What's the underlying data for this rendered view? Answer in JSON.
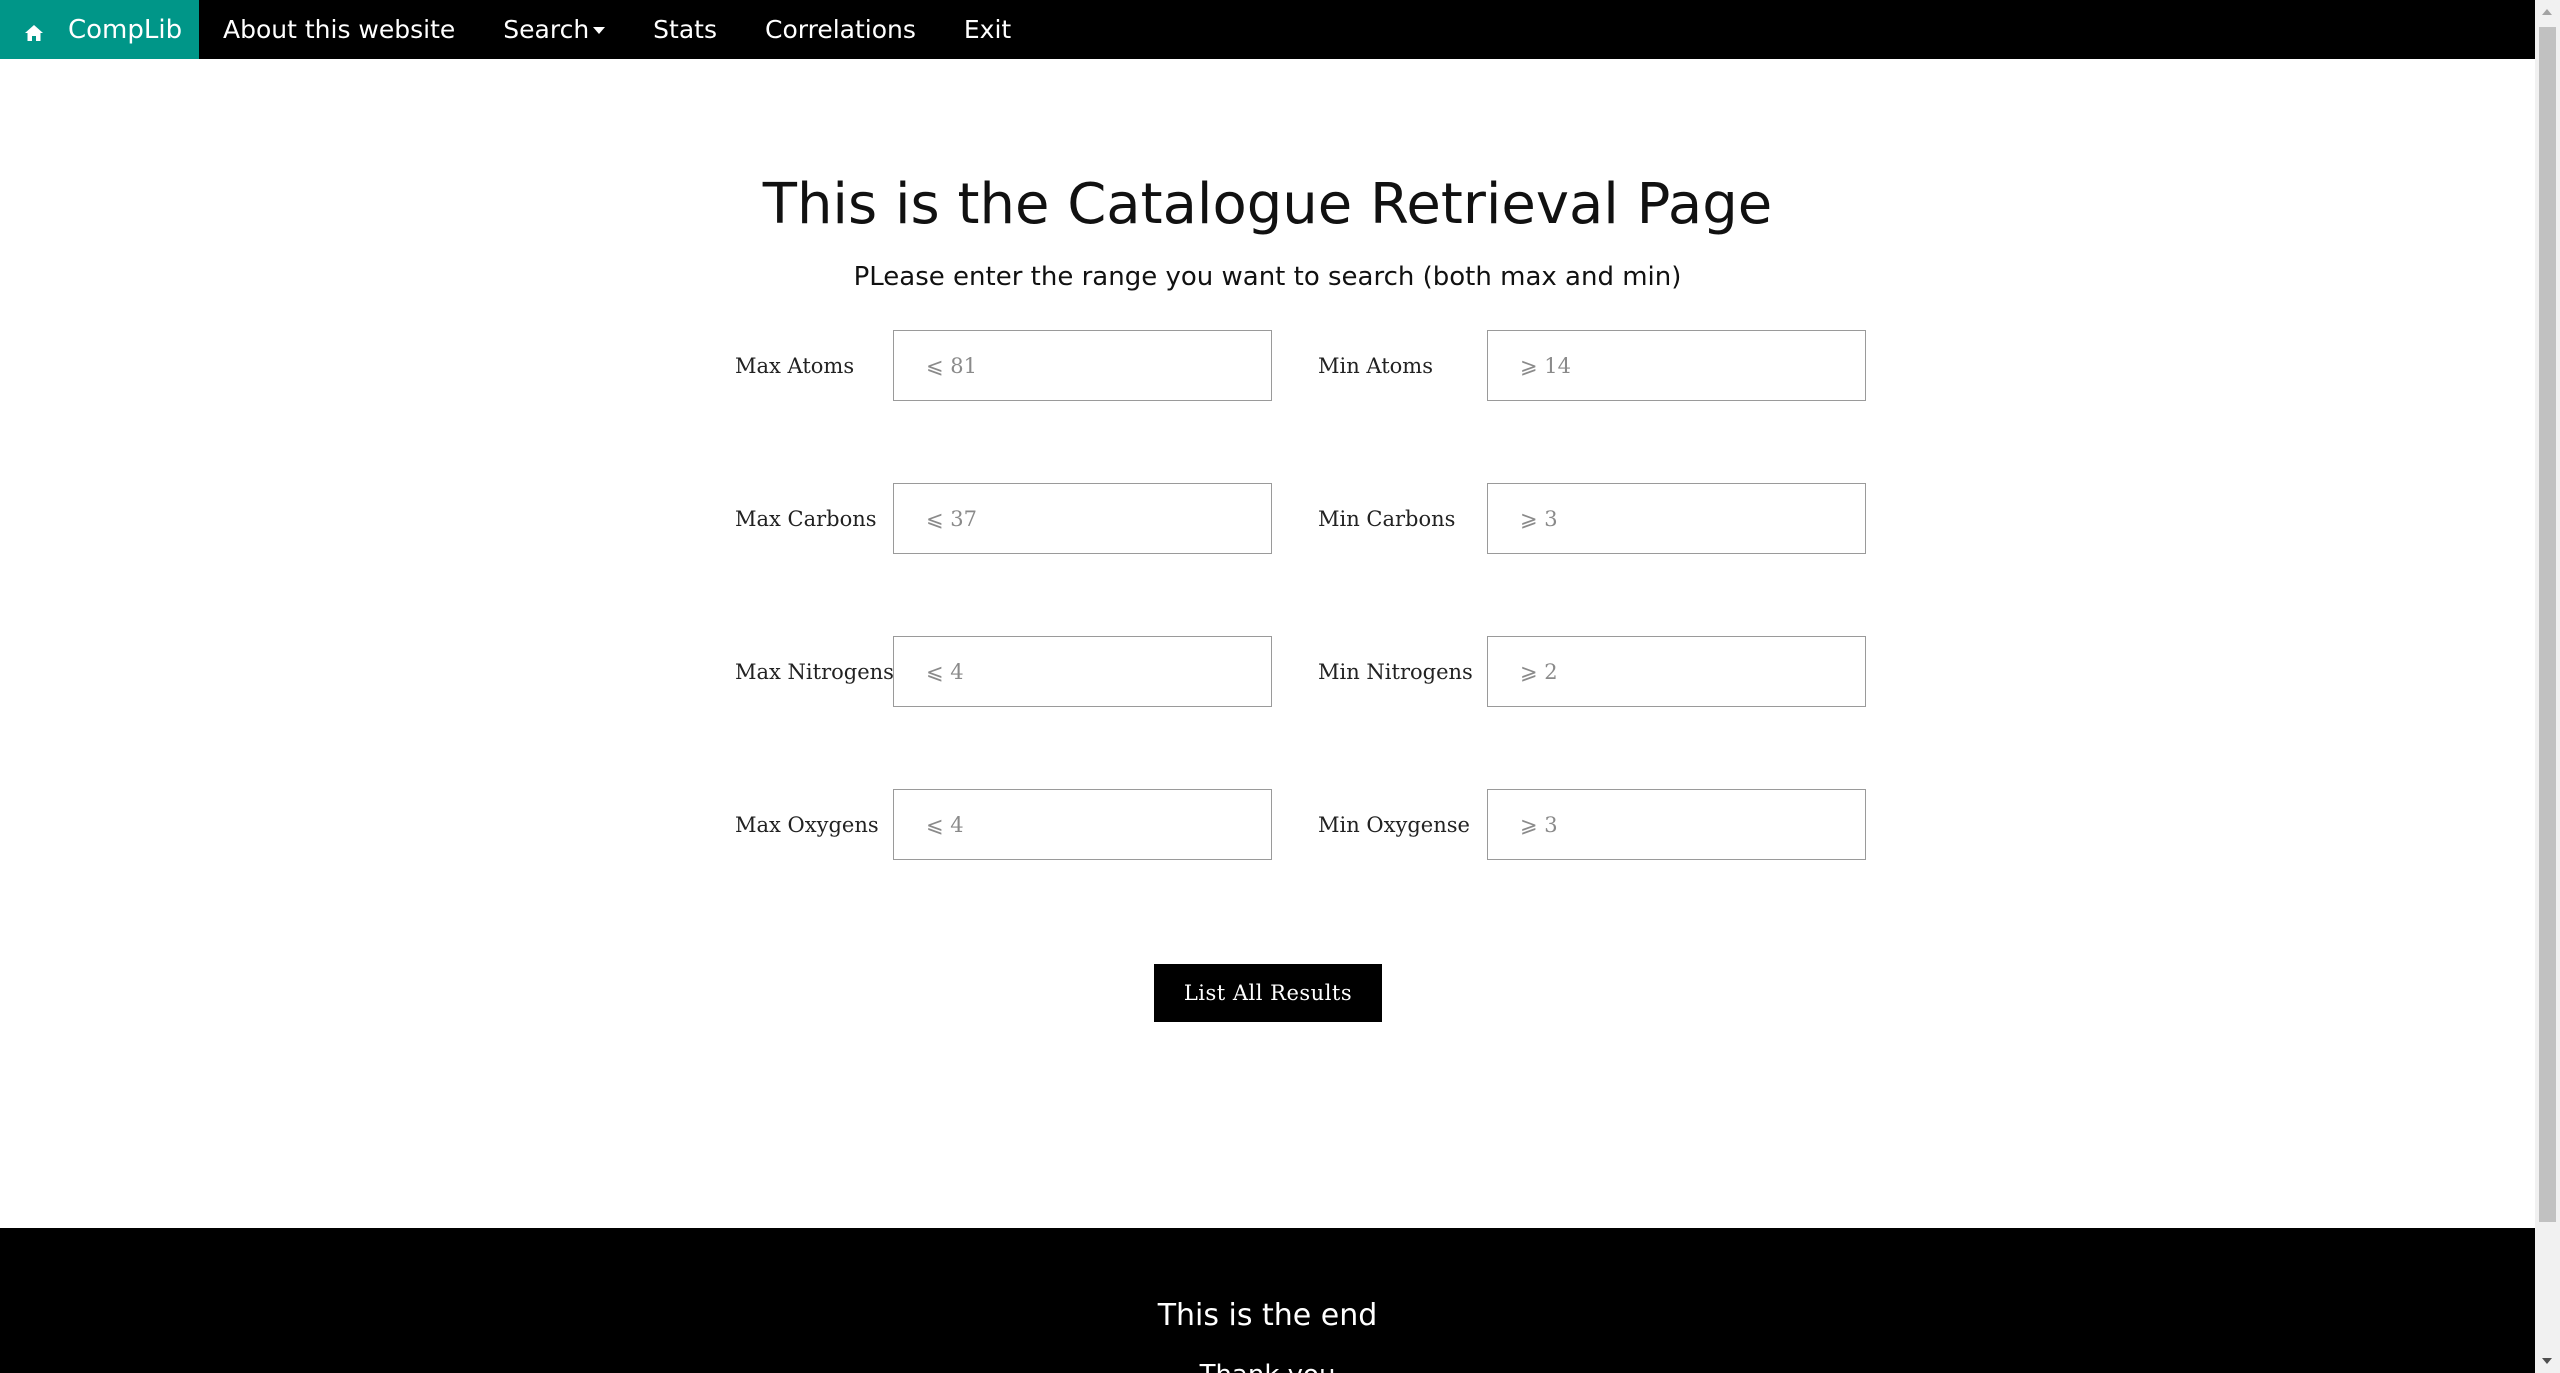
{
  "navbar": {
    "brand": "CompLib",
    "brand_icon": "home-icon",
    "items": [
      {
        "label": "About this website"
      },
      {
        "label": "Search",
        "has_caret": true
      },
      {
        "label": "Stats"
      },
      {
        "label": "Correlations"
      },
      {
        "label": "Exit"
      }
    ]
  },
  "main": {
    "title": "This is the Catalogue Retrieval Page",
    "subtitle": "PLease enter the range you want to search (both max and min)",
    "fields": {
      "max_atoms": {
        "label": "Max Atoms",
        "placeholder": "⩽ 81"
      },
      "min_atoms": {
        "label": "Min Atoms",
        "placeholder": "⩾ 14"
      },
      "max_carbons": {
        "label": "Max Carbons",
        "placeholder": "⩽ 37"
      },
      "min_carbons": {
        "label": "Min Carbons",
        "placeholder": "⩾ 3"
      },
      "max_nitrogens": {
        "label": "Max Nitrogens",
        "placeholder": "⩽ 4"
      },
      "min_nitrogens": {
        "label": "Min Nitrogens",
        "placeholder": "⩾ 2"
      },
      "max_oxygens": {
        "label": "Max Oxygens",
        "placeholder": "⩽ 4"
      },
      "min_oxygens": {
        "label": "Min Oxygense",
        "placeholder": "⩾ 3"
      }
    },
    "button_label": "List All Results"
  },
  "footer": {
    "title": "This is the end",
    "subtitle": "Thank you"
  },
  "colors": {
    "brand": "#009688",
    "navbar_bg": "#000000",
    "footer_bg": "#000000"
  }
}
